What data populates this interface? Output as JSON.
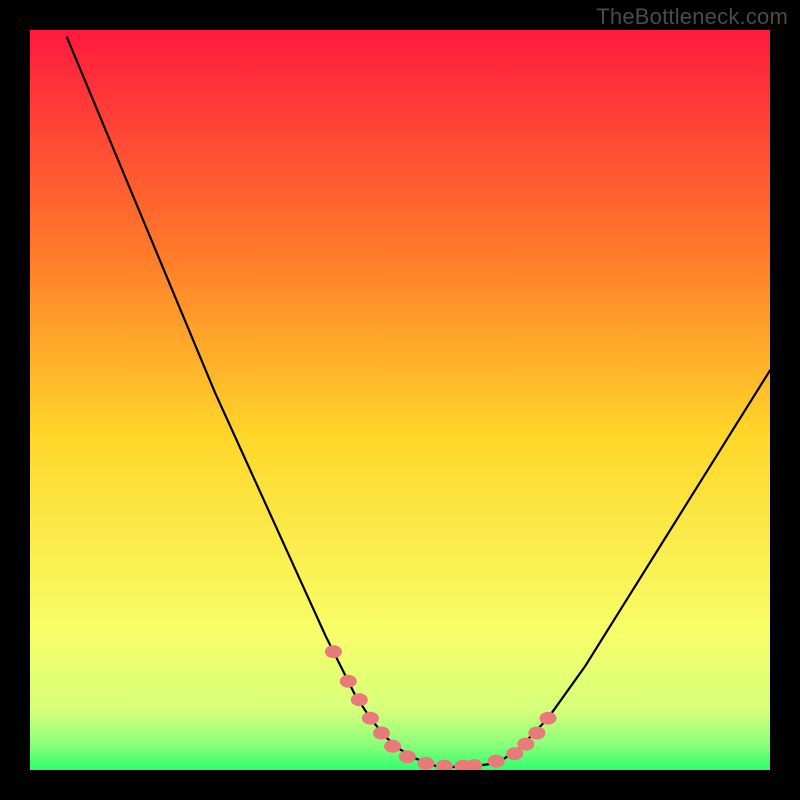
{
  "watermark": "TheBottleneck.com",
  "colors": {
    "bg": "#000000",
    "gradient_top": "#ff1a3f",
    "gradient_mid_upper": "#ff7a2a",
    "gradient_mid": "#ffd72a",
    "gradient_lower": "#f7ff6a",
    "gradient_bottom": "#2eff6e",
    "curve": "#000000",
    "marker": "#e97a7a",
    "watermark": "#4b4b4b"
  },
  "chart_data": {
    "type": "line",
    "title": "",
    "xlabel": "",
    "ylabel": "",
    "xlim": [
      0,
      100
    ],
    "ylim": [
      0,
      100
    ],
    "series": [
      {
        "name": "curve",
        "x": [
          5,
          10,
          15,
          20,
          25,
          30,
          35,
          40,
          42,
          44,
          46,
          48,
          50,
          52,
          54,
          55,
          57,
          60,
          62,
          64,
          66,
          70,
          75,
          80,
          85,
          90,
          95,
          100
        ],
        "y": [
          99,
          87,
          75,
          63,
          51,
          40,
          29,
          18,
          14,
          10,
          7,
          4.5,
          2.8,
          1.6,
          0.8,
          0.5,
          0.4,
          0.5,
          0.8,
          1.5,
          2.8,
          7,
          14,
          22,
          30,
          38,
          46,
          54
        ]
      }
    ],
    "markers": {
      "name": "highlighted-points",
      "x": [
        41,
        43,
        44.5,
        46,
        47.5,
        49,
        51,
        53.5,
        56,
        58.5,
        60,
        63,
        65.5,
        67,
        68.5,
        70
      ],
      "y": [
        16,
        12,
        9.5,
        7,
        5,
        3.2,
        1.8,
        0.9,
        0.5,
        0.5,
        0.6,
        1.2,
        2.2,
        3.5,
        5,
        7
      ]
    }
  }
}
